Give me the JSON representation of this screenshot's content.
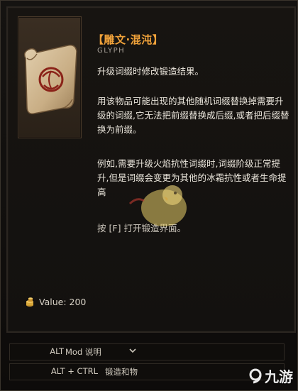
{
  "item": {
    "name": "【雕文·混沌】",
    "type": "GLYPH",
    "icon_name": "glyph-scroll-icon",
    "desc1": "升级词缀时修改锻造结果。",
    "desc2": "用该物品可能出现的其他随机词缀替换掉需要升级的词缀,它无法把前缀替换成后缀,或者把后缀替换为前缀。",
    "desc3": "例如,需要升级火焰抗性词缀时,词缀阶级正常提升,但是词缀会变更为其他的冰霜抗性或者生命提高",
    "hint_prefix": "按",
    "hint_key": "[F]",
    "hint_suffix": "打开锻造界面。"
  },
  "value": {
    "label": "Value: 200",
    "icon_name": "coin-stack-icon"
  },
  "controls": [
    {
      "key": "ALT",
      "action": "Mod 说明"
    },
    {
      "key": "ALT + CTRL",
      "action": "锻造和物"
    }
  ],
  "watermark": {
    "text": "九游",
    "icon_name": "9game-logo-icon"
  },
  "colors": {
    "title": "#f0a23a",
    "text": "#ebe6dc",
    "subtext": "#a6a097",
    "background": "#13110f"
  }
}
